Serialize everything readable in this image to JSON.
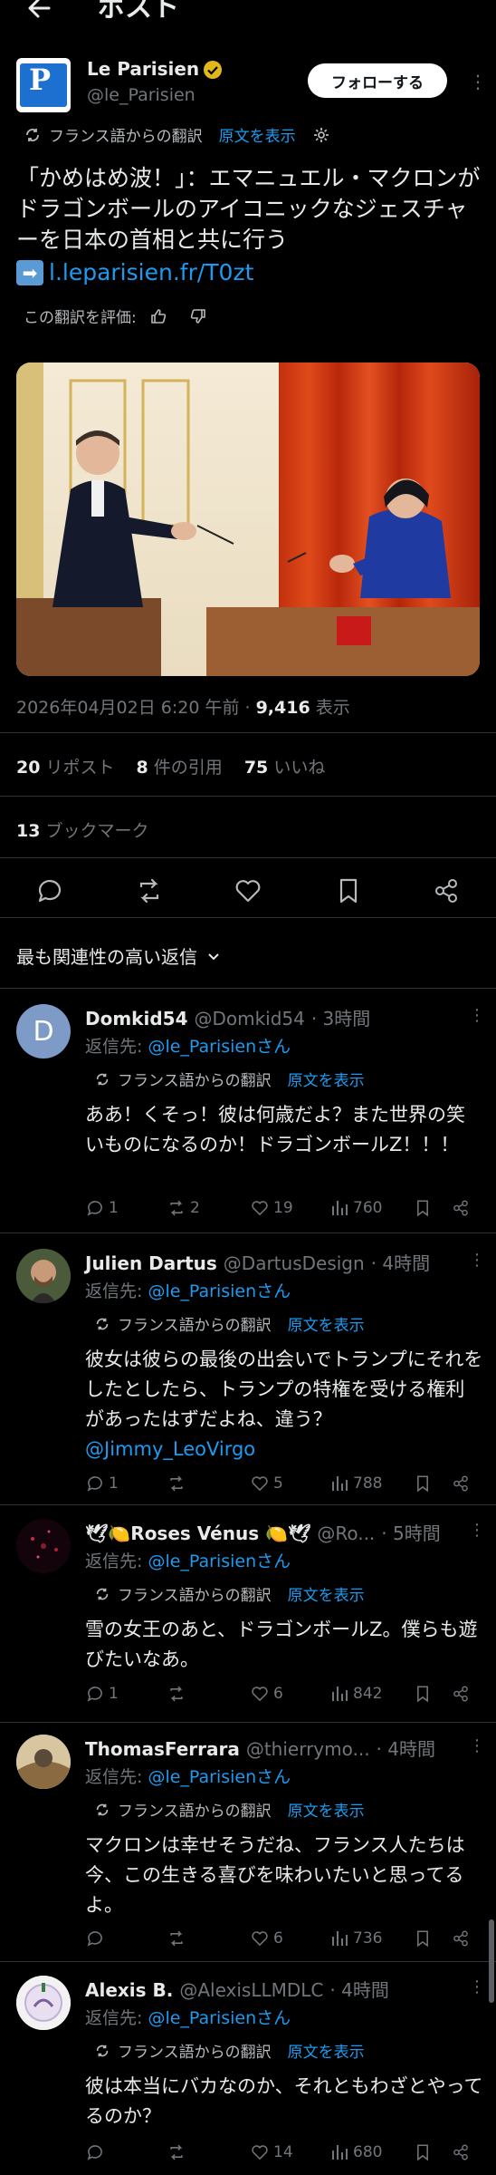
{
  "header": {
    "title": "ポスト"
  },
  "post": {
    "author_name": "Le Parisien",
    "author_handle": "@le_Parisien",
    "avatar_letter": "P",
    "follow_label": "フォローする",
    "translation_label": "フランス語からの翻訳",
    "show_original": "原文を表示",
    "text": "「かめはめ波！」：エマニュエル・マクロンがドラゴンボールのアイコニックなジェスチャーを日本の首相と共に行う",
    "link": "l.leparisien.fr/T0zt",
    "rate_label": "この翻訳を評価:",
    "timestamp": "2026年04月02日 6:20 午前",
    "views_count": "9,416",
    "views_label": "表示",
    "reposts_count": "20",
    "reposts_label": "リポスト",
    "quotes_count": "8",
    "quotes_label": "件の引用",
    "likes_count": "75",
    "likes_label": "いいね",
    "bookmarks_count": "13",
    "bookmarks_label": "ブックマーク"
  },
  "sort_label": "最も関連性の高い返信",
  "replies": [
    {
      "name": "Domkid54",
      "handle": "@Domkid54",
      "time": "· 3時間",
      "avatar_letter": "D",
      "reply_to_prefix": "返信先: ",
      "reply_to": "@le_Parisienさん",
      "translation_label": "フランス語からの翻訳",
      "show_original": "原文を表示",
      "text": "ああ！くそっ！彼は何歳だよ？また世界の笑いものになるのか！ドラゴンボールZ！！！",
      "replies": "1",
      "reposts": "2",
      "likes": "19",
      "views": "760"
    },
    {
      "name": "Julien Dartus",
      "handle": "@DartusDesign",
      "time": "· 4時間",
      "reply_to_prefix": "返信先: ",
      "reply_to": "@le_Parisienさん",
      "translation_label": "フランス語からの翻訳",
      "show_original": "原文を表示",
      "text": "彼女は彼らの最後の出会いでトランプにそれをしたとしたら、トランプの特権を受ける権利があったはずだよね、違う？",
      "mention": "@Jimmy_LeoVirgo",
      "replies": "1",
      "reposts": "",
      "likes": "5",
      "views": "788"
    },
    {
      "name": "🕊🍋Roses Vénus 🍋🕊",
      "handle": "@Ro...",
      "time": "· 5時間",
      "reply_to_prefix": "返信先: ",
      "reply_to": "@le_Parisienさん",
      "translation_label": "フランス語からの翻訳",
      "show_original": "原文を表示",
      "text": "雪の女王のあと、ドラゴンボールZ。僕らも遊びたいなあ。",
      "replies": "1",
      "reposts": "",
      "likes": "6",
      "views": "842"
    },
    {
      "name": "ThomasFerrara",
      "handle": "@thierrymo...",
      "time": "· 4時間",
      "reply_to_prefix": "返信先: ",
      "reply_to": "@le_Parisienさん",
      "translation_label": "フランス語からの翻訳",
      "show_original": "原文を表示",
      "text": "マクロンは幸せそうだね、フランス人たちは今、この生きる喜びを味わいたいと思ってるよ。",
      "replies": "",
      "reposts": "",
      "likes": "6",
      "views": "736"
    },
    {
      "name": "Alexis B.",
      "handle": "@AlexisLLMDLC",
      "time": "· 4時間",
      "reply_to_prefix": "返信先: ",
      "reply_to": "@le_Parisienさん",
      "translation_label": "フランス語からの翻訳",
      "show_original": "原文を表示",
      "text": "彼は本当にバカなのか、それともわざとやってるのか？",
      "replies": "",
      "reposts": "",
      "likes": "14",
      "views": "680"
    }
  ],
  "colors": {
    "background": "#000000",
    "text": "#e7e9ea",
    "muted": "#71767b",
    "accent": "#1d9bf0",
    "verified": "#e2b719",
    "brand": "#1d6fd0"
  },
  "icons": [
    "back-arrow-icon",
    "verified-badge-icon",
    "more-icon",
    "translate-icon",
    "settings-icon",
    "thumbs-up-icon",
    "thumbs-down-icon",
    "arrow-link-icon",
    "reply-icon",
    "repost-icon",
    "like-icon",
    "bookmark-icon",
    "share-icon",
    "views-icon",
    "chevron-down-icon"
  ]
}
